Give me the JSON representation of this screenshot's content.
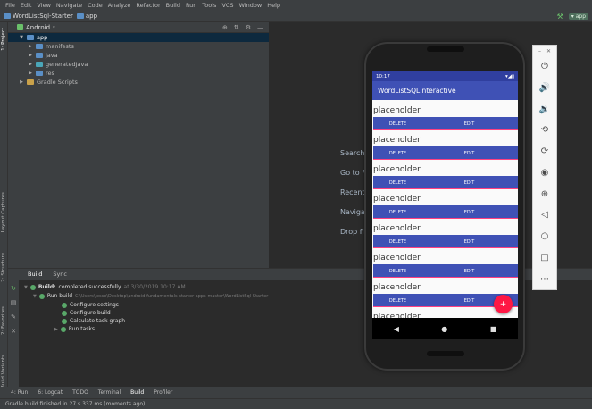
{
  "menu": [
    "File",
    "Edit",
    "View",
    "Navigate",
    "Code",
    "Analyze",
    "Refactor",
    "Build",
    "Run",
    "Tools",
    "VCS",
    "Window",
    "Help"
  ],
  "nav": {
    "project": "WordListSql-Starter",
    "module": "app",
    "device_short": "app"
  },
  "left_strip": {
    "project": "1: Project",
    "layout_captures": "Layout Captures",
    "structure": "2: Structure",
    "favorites": "2: Favorites",
    "build_variants": "Build Variants"
  },
  "project_panel": {
    "view": "Android",
    "tree": [
      {
        "label": "app",
        "level": 0,
        "expanded": true,
        "selected": true,
        "folder": "blue"
      },
      {
        "label": "manifests",
        "level": 1,
        "expanded": false,
        "folder": "blue"
      },
      {
        "label": "java",
        "level": 1,
        "expanded": false,
        "folder": "blue"
      },
      {
        "label": "generatedJava",
        "level": 1,
        "expanded": false,
        "folder": "teal"
      },
      {
        "label": "res",
        "level": 1,
        "expanded": false,
        "folder": "blue"
      },
      {
        "label": "Gradle Scripts",
        "level": 0,
        "expanded": false,
        "folder": "yellow"
      }
    ]
  },
  "editor_hints": [
    "Search",
    "Go to F",
    "Recent",
    "Naviga",
    "Drop fi"
  ],
  "build": {
    "tabs": [
      "Build",
      "Sync"
    ],
    "status_prefix": "Build:",
    "status": "completed successfully",
    "time": "at 3/30/2019 10:17 AM",
    "run_build": "Run build",
    "path": "C:\\Users\\jesse\\Desktop\\android-fundamentals-starter-apps-master\\WordListSql-Starter",
    "steps": [
      "Configure settings",
      "Configure build",
      "Calculate task graph",
      "Run tasks"
    ]
  },
  "bottom_tabs": [
    "4: Run",
    "6: Logcat",
    "TODO",
    "Terminal",
    "Build",
    "Profiler"
  ],
  "status_bar": "Gradle build finished in 27 s 337 ms (moments ago)",
  "phone": {
    "time": "10:17",
    "app_title": "WordListSQLInteractive",
    "items": [
      "placeholder",
      "placeholder",
      "placeholder",
      "placeholder",
      "placeholder",
      "placeholder",
      "placeholder"
    ],
    "partial_item": "placeholder",
    "delete_label": "DELETE",
    "edit_label": "EDIT",
    "fab_label": "+"
  },
  "colors": {
    "primary": "#3f51b5",
    "primary_dark": "#303f9f",
    "accent": "#ff1744",
    "ide_bg": "#2b2b2b",
    "ide_panel": "#3c3f41"
  },
  "emulator_controls": [
    "power-icon",
    "volume-up-icon",
    "volume-down-icon",
    "rotate-left-icon",
    "rotate-right-icon",
    "camera-icon",
    "zoom-icon",
    "back-icon",
    "home-icon",
    "overview-icon",
    "more-icon"
  ]
}
